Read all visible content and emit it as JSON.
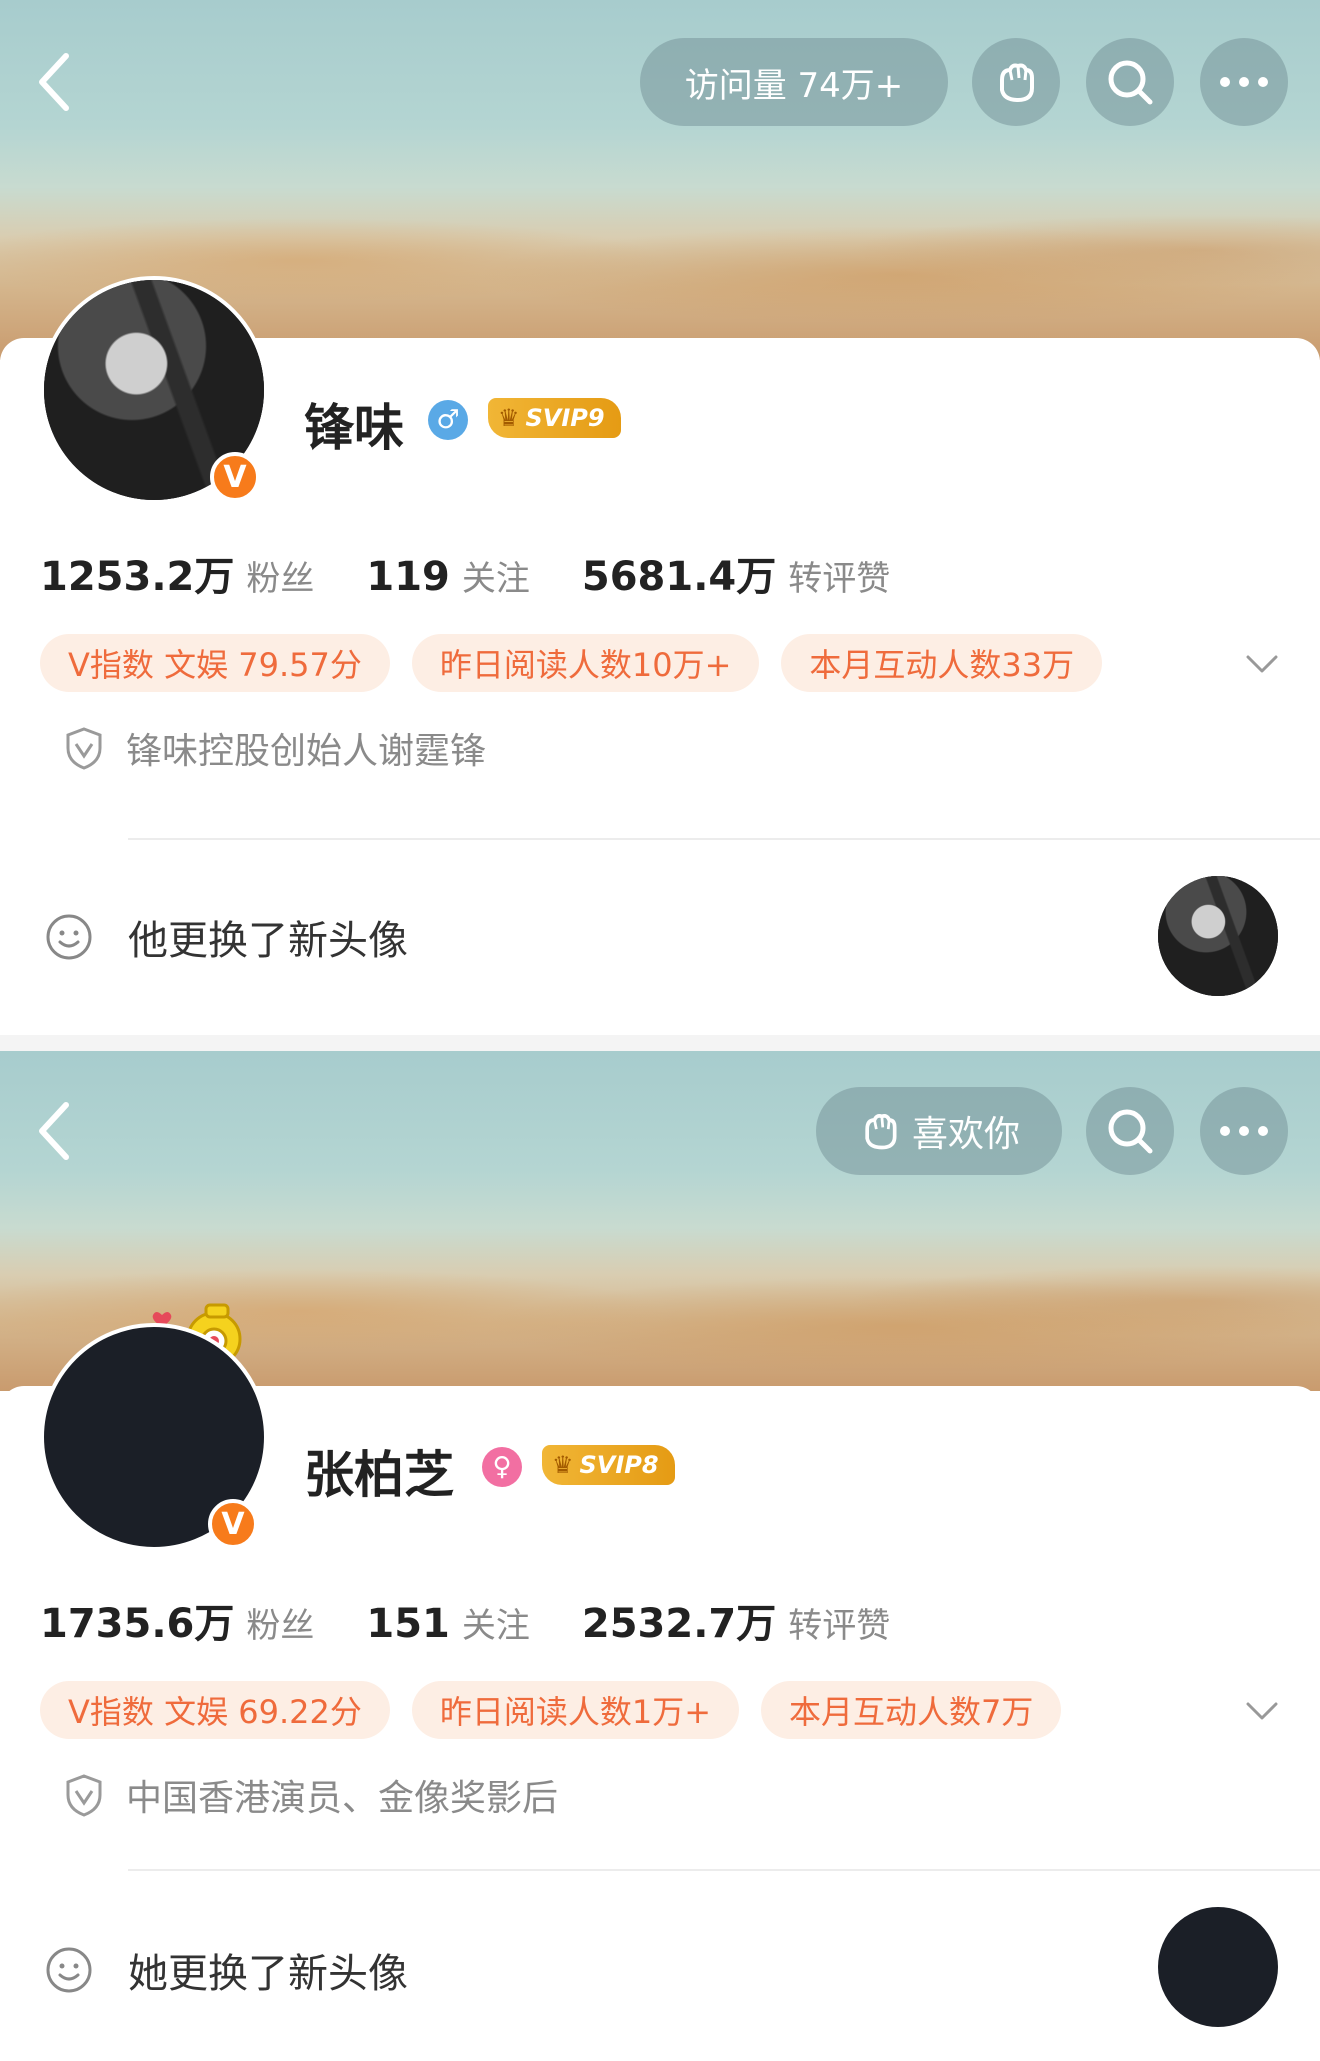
{
  "profiles": [
    {
      "header": {
        "visits": "访问量 74万+",
        "like_label": ""
      },
      "name": "锋味",
      "gender_icon": "male-icon",
      "gender_symbol": "♂",
      "gender_color": "#5aa9e6",
      "svip": "SVIP9",
      "stats": {
        "fans_num": "1253.2万",
        "fans_lbl": "粉丝",
        "follow_num": "119",
        "follow_lbl": "关注",
        "like_num": "5681.4万",
        "like_lbl": "转评赞"
      },
      "tags": [
        "V指数 文娱 79.57分",
        "昨日阅读人数10万+",
        "本月互动人数33万"
      ],
      "auth": "锋味控股创始人谢霆锋",
      "feed": "他更换了新头像"
    },
    {
      "header": {
        "visits": "",
        "like_label": "喜欢你"
      },
      "name": "张柏芝",
      "gender_icon": "female-icon",
      "gender_symbol": "♀",
      "gender_color": "#f26fa2",
      "svip": "SVIP8",
      "stats": {
        "fans_num": "1735.6万",
        "fans_lbl": "粉丝",
        "follow_num": "151",
        "follow_lbl": "关注",
        "like_num": "2532.7万",
        "like_lbl": "转评赞"
      },
      "tags": [
        "V指数 文娱 69.22分",
        "昨日阅读人数1万+",
        "本月互动人数7万"
      ],
      "auth": "中国香港演员、金像奖影后",
      "feed": "她更换了新头像"
    }
  ],
  "colors": {
    "tag_bg": "#fdeee4",
    "tag_text": "#ef6b3c",
    "verified": "#f77b1b"
  }
}
